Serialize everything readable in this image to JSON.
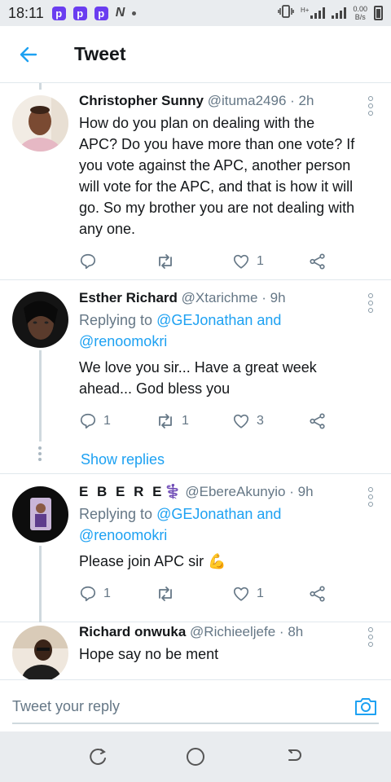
{
  "status_bar": {
    "time": "18:11",
    "notification_icons": [
      "p-app-icon",
      "p-app-icon",
      "p-app-icon",
      "n-app-icon"
    ],
    "network_type": "H+",
    "net_speed_value": "0.00",
    "net_speed_unit": "B/s"
  },
  "header": {
    "title": "Tweet"
  },
  "tweets": [
    {
      "name": "Christopher Sunny",
      "handle": "@ituma2496",
      "time": "2h",
      "text": "How do you plan on dealing with the APC? Do you have more than one vote? If you vote against the APC, another person will vote for the APC, and that is how it will go. So my brother you are not dealing with any one.",
      "reply_count": "",
      "retweet_count": "",
      "like_count": "1"
    },
    {
      "name": "Esther Richard",
      "handle": "@Xtarichme",
      "time": "9h",
      "replying_prefix": "Replying to ",
      "replying_to": "@GEJonathan and @renoomokri",
      "text": "We love you sir... Have a great week ahead... God bless you",
      "reply_count": "1",
      "retweet_count": "1",
      "like_count": "3",
      "show_replies": "Show replies"
    },
    {
      "name": "E B E R E",
      "name_emoji": "⚕️",
      "handle": "@EbereAkunyio",
      "time": "9h",
      "replying_prefix": "Replying to ",
      "replying_to": "@GEJonathan and @renoomokri",
      "text": "Please join APC sir",
      "text_emoji": "💪",
      "reply_count": "1",
      "retweet_count": "",
      "like_count": "1"
    },
    {
      "name": "Richard onwuka",
      "handle": "@Richieeljefe",
      "time": "8h",
      "text": "Hope say no be ment"
    }
  ],
  "reply_bar": {
    "placeholder": "Tweet your reply"
  },
  "colors": {
    "accent": "#1da1f2",
    "text_primary": "#14171a",
    "text_secondary": "#657786",
    "divider": "#e1e8ed"
  }
}
